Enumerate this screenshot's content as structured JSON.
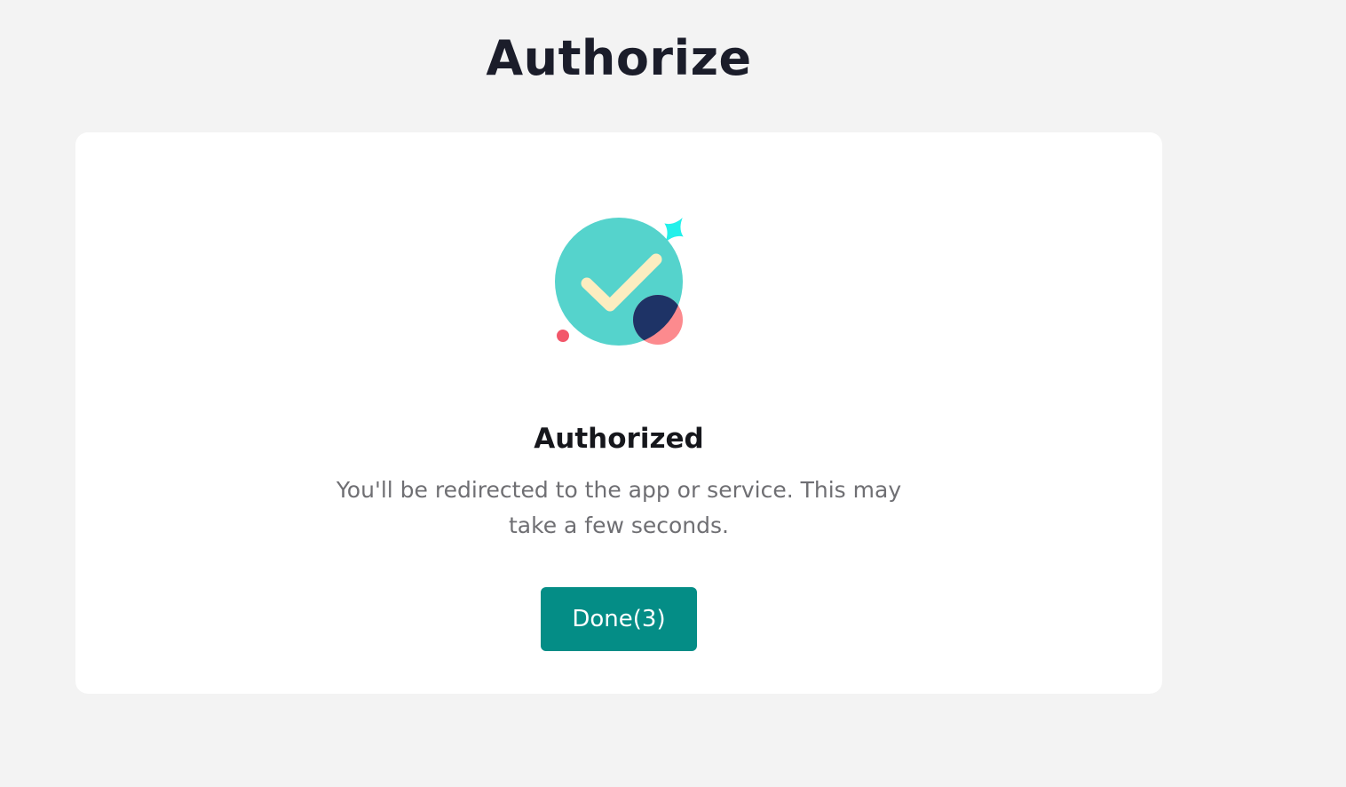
{
  "page": {
    "title": "Authorize"
  },
  "card": {
    "illustration_icon": "success-checkmark-icon",
    "status_title": "Authorized",
    "status_message": "You'll be redirected to the app or service. This may take a few seconds.",
    "done_button_label": "Done(3)"
  },
  "colors": {
    "background": "#f3f3f3",
    "card": "#ffffff",
    "button": "#048d86",
    "title_text": "#1b1d2a",
    "message_text": "#6f6f73",
    "illustration_circle": "#55d3cc",
    "illustration_check": "#fcedc0",
    "illustration_navy": "#1e3366",
    "illustration_pink": "#fc8a8e",
    "illustration_sparkle": "#23f0ea",
    "illustration_dot": "#f2576a"
  }
}
